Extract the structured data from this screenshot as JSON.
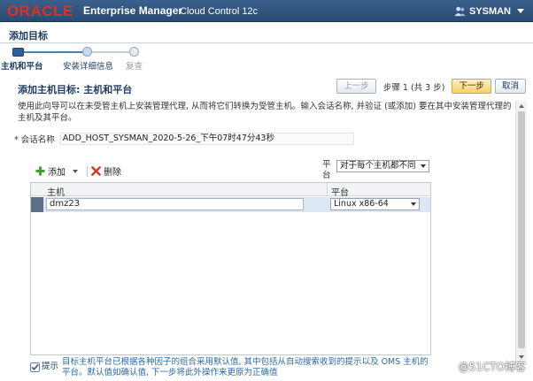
{
  "header": {
    "brand": "ORACLE",
    "product": "Enterprise Manager",
    "edition": "Cloud Control 12c",
    "user": "SYSMAN"
  },
  "page": {
    "title": "添加目标"
  },
  "train": {
    "steps": [
      {
        "label": "主机和平台",
        "state": "active"
      },
      {
        "label": "安装详细信息",
        "state": "next"
      },
      {
        "label": "复查",
        "state": "disabled"
      }
    ]
  },
  "section": {
    "title": "添加主机目标: 主机和平台",
    "back_label": "上一步",
    "step_text": "步骤 1 (共 3 步)",
    "next_label": "下一步",
    "cancel_label": "取消"
  },
  "description": "使用此向导可以在未受管主机上安装管理代理, 从而将它们转换为受管主机。输入会话名称, 并验证 (或添加) 要在其中安装管理代理的主机及其平台。",
  "session": {
    "label": "* 会话名称",
    "value": "ADD_HOST_SYSMAN_2020-5-26_下午07时47分43秒"
  },
  "toolbar": {
    "add_label": "添加",
    "remove_label": "删除"
  },
  "platform_filter": {
    "label": "平台",
    "value": "对于每个主机都不同"
  },
  "table": {
    "columns": [
      "主机",
      "平台"
    ],
    "rows": [
      {
        "host": "dmz23",
        "platform": "Linux x86-64"
      }
    ]
  },
  "hint": {
    "label": "提示",
    "text": "目标主机平台已根据各种因子的组合采用默认值, 其中包括从自动搜索收到的提示以及 OMS 主机的平台。默认值如确认值, 下一步将此外操作来更原为正确值"
  },
  "watermark": "@51CTO博客",
  "colors": {
    "header_bg": "#294a72",
    "brand_red": "#e0301e",
    "next_button": "#f7cf6b",
    "selected_row": "#dde7f4"
  }
}
